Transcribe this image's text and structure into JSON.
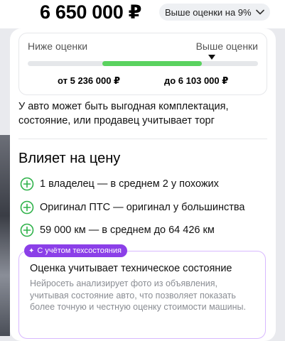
{
  "header": {
    "price": "6 650 000 ₽",
    "badge_label": "Выше оценки на 9%"
  },
  "scale": {
    "label_low": "Ниже оценки",
    "label_high": "Выше оценки",
    "range_from": "от 5 236 000 ₽",
    "range_to": "до 6 103 000 ₽"
  },
  "note": "У авто может быть выгодная комплектация, состояние, или продавец учитывает торг",
  "influence": {
    "title": "Влияет на цену",
    "factors": [
      {
        "text": "1 владелец — в среднем 2 у похожих"
      },
      {
        "text": "Оригинал ПТС — оригинал у большинства"
      },
      {
        "text": "59 000 км — в среднем до 64 426 км"
      }
    ]
  },
  "tech": {
    "tag": "С учётом техсостояния",
    "title": "Оценка учитывает техническое состояние",
    "description": "Нейросеть анализирует фото из объявления, учитывая состояние авто, что позволяет показать более точную и честную оценку стоимости машины."
  },
  "colors": {
    "accent_green": "#5ad25f",
    "tag_purple": "#8b3fe8",
    "plus_green": "#2fb24a"
  },
  "icons": {
    "badge": "chevron-down-icon",
    "factor": "plus-circle-icon",
    "tag": "sparkle-icon",
    "scale": "price-marker-icon"
  }
}
